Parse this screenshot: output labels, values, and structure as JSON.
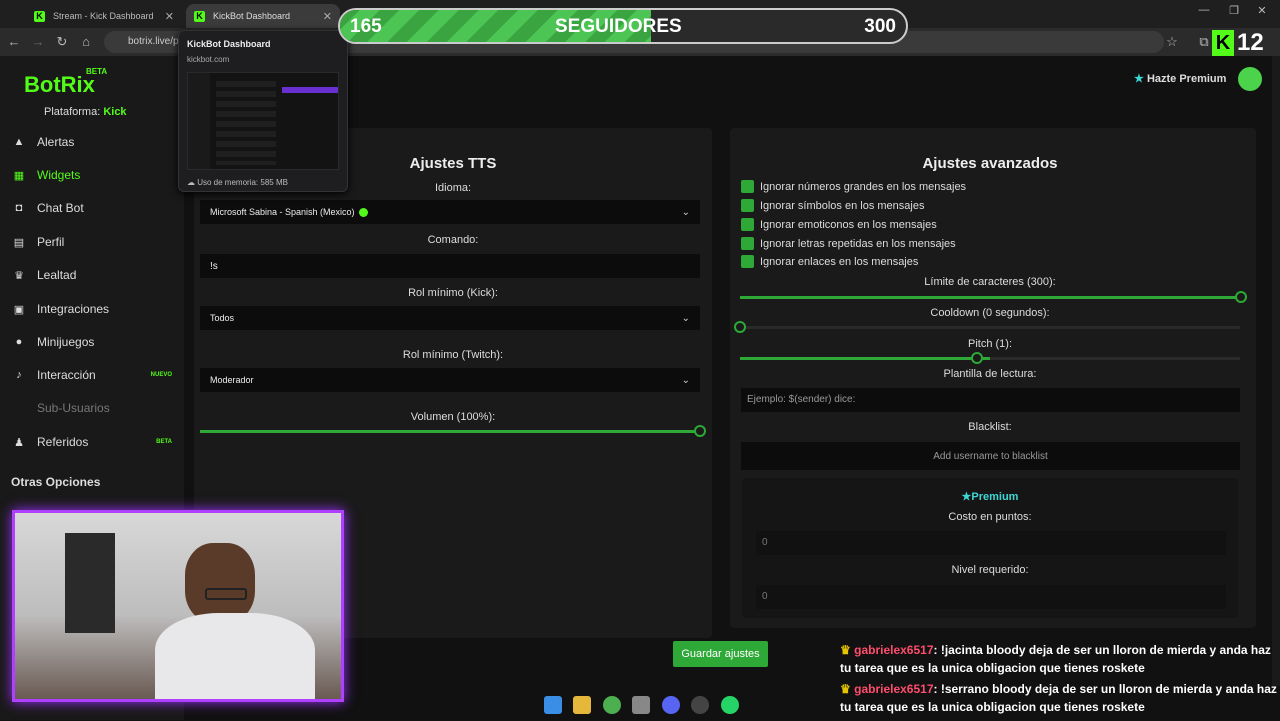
{
  "browser": {
    "tabs": [
      {
        "label": "Stream - Kick Dashboard",
        "favicon": "K"
      },
      {
        "label": "KickBot Dashboard",
        "favicon": "K"
      }
    ],
    "close": "✕",
    "url": "botrix.live/p",
    "tooltip": {
      "title": "KickBot Dashboard",
      "domain": "kickbot.com",
      "memory": "Uso de memoria: 585 MB"
    }
  },
  "overlay": {
    "follower_current": "165",
    "follower_label": "SEGUIDORES",
    "follower_goal": "300",
    "follower_progress": 0.55,
    "kick_count": "12",
    "kick_letter": "K"
  },
  "sidebar": {
    "logo": "BotRix",
    "beta": "BETA",
    "platform_label": "Plataforma:",
    "platform_value": "Kick",
    "items": [
      {
        "label": "Alertas",
        "icon": "warning-icon"
      },
      {
        "label": "Widgets",
        "icon": "grid-icon"
      },
      {
        "label": "Chat Bot",
        "icon": "robot-icon"
      },
      {
        "label": "Perfil",
        "icon": "id-card-icon"
      },
      {
        "label": "Lealtad",
        "icon": "trophy-icon"
      },
      {
        "label": "Integraciones",
        "icon": "plug-icon"
      },
      {
        "label": "Minijuegos",
        "icon": "gamepad-icon"
      },
      {
        "label": "Interacción",
        "icon": "music-icon",
        "tag": "NUEVO"
      },
      {
        "label": "Sub-Usuarios",
        "icon": "",
        "tag": ""
      },
      {
        "label": "Referidos",
        "icon": "users-icon",
        "tag": "BETA"
      }
    ],
    "other_options": "Otras Opciones"
  },
  "header": {
    "premium": "Hazte Premium"
  },
  "tts": {
    "title": "Ajustes TTS",
    "language_label": "Idioma:",
    "language_value": "Microsoft Sabina - Spanish (Mexico)",
    "command_label": "Comando:",
    "command_value": "!s",
    "role_kick_label": "Rol mínimo (Kick):",
    "role_kick_value": "Todos",
    "role_twitch_label": "Rol mínimo (Twitch):",
    "role_twitch_value": "Moderador",
    "volume_label": "Volumen (100%):",
    "volume": 1.0
  },
  "advanced": {
    "title": "Ajustes avanzados",
    "checks": [
      "Ignorar números grandes en los mensajes",
      "Ignorar símbolos en los mensajes",
      "Ignorar emoticonos en los mensajes",
      "Ignorar letras repetidas en los mensajes",
      "Ignorar enlaces en los mensajes"
    ],
    "char_limit_label": "Límite de caracteres (300):",
    "char_limit": 1.0,
    "cooldown_label": "Cooldown (0 segundos):",
    "cooldown": 0.0,
    "pitch_label": "Pitch (1):",
    "pitch": 0.5,
    "template_label": "Plantilla de lectura:",
    "template_placeholder": "Ejemplo: $(sender) dice:",
    "blacklist_label": "Blacklist:",
    "blacklist_placeholder": "Add username to blacklist",
    "premium_title": "Premium",
    "cost_label": "Costo en puntos:",
    "cost_value": "0",
    "level_label": "Nivel requerido:",
    "level_value": "0"
  },
  "save_button": "Guardar ajustes",
  "chat": [
    {
      "user": "gabrielex6517",
      "text": ": !jacinta bloody deja de ser un lloron de mierda y anda haz tu tarea que es la unica obligacion que tienes roskete"
    },
    {
      "user": "gabrielex6517",
      "text": ": !serrano bloody deja de ser un lloron de mierda y anda haz tu tarea que es la unica obligacion que tienes roskete"
    }
  ]
}
